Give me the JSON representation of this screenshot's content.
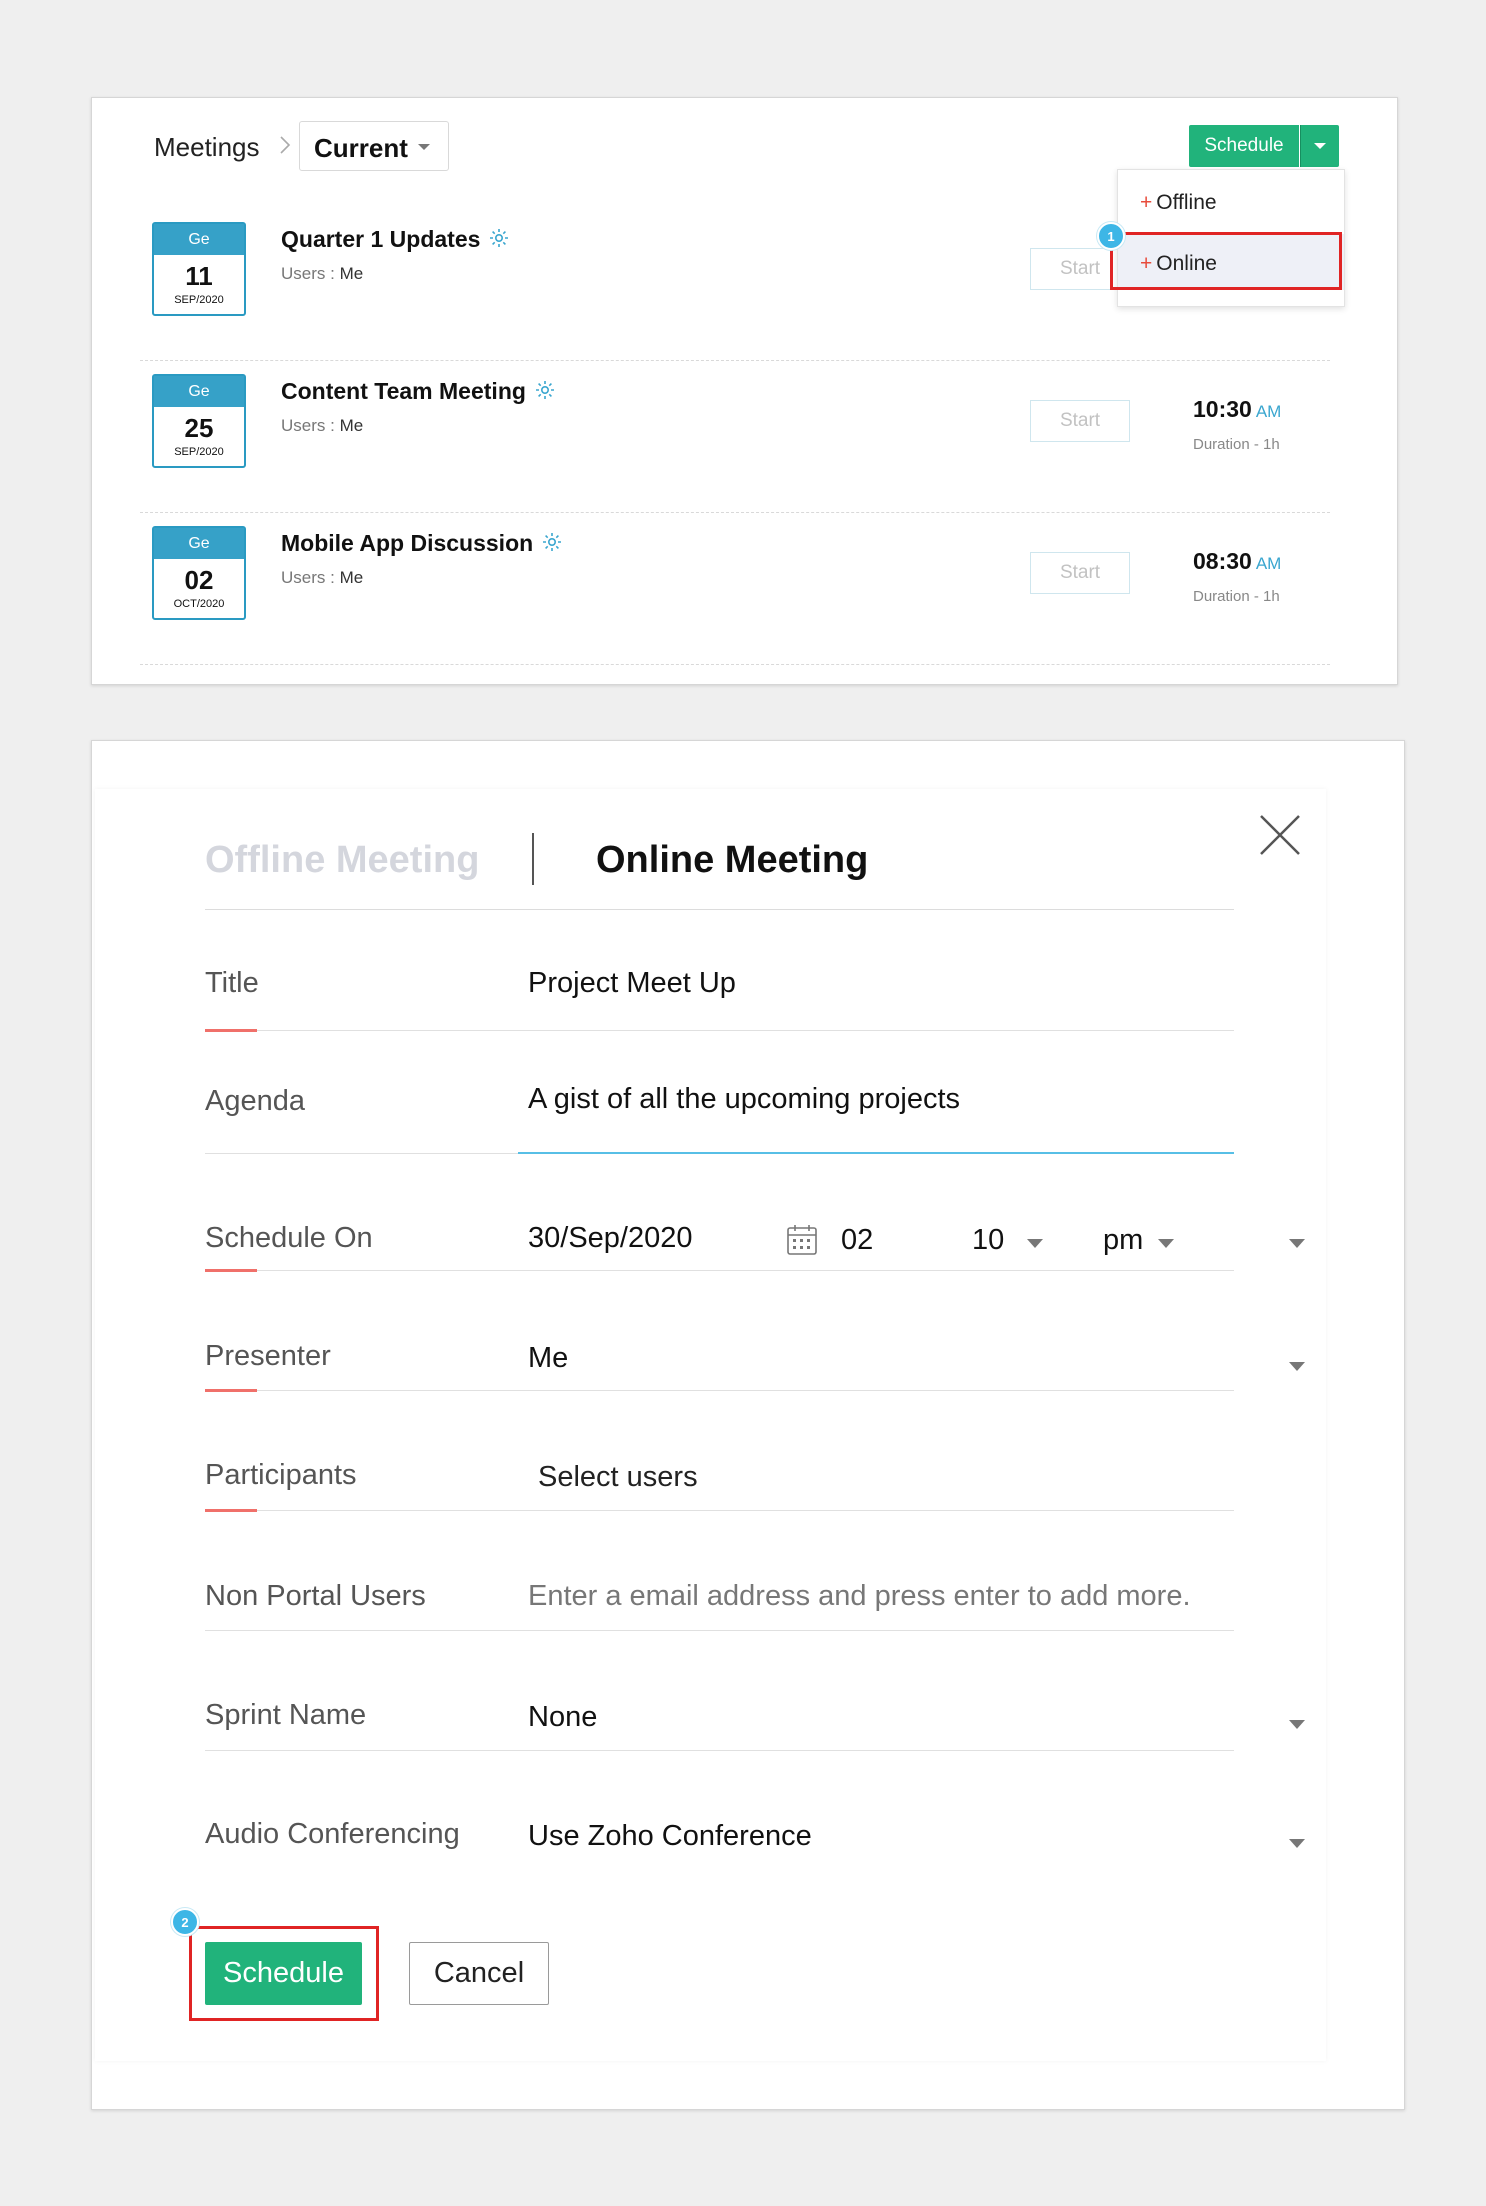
{
  "breadcrumb": {
    "root": "Meetings",
    "separator": ">",
    "current": "Current"
  },
  "schedule_button": {
    "label": "Schedule"
  },
  "schedule_menu": {
    "items": [
      {
        "plus": "+",
        "label": "Offline"
      },
      {
        "plus": "+",
        "label": "Online"
      }
    ]
  },
  "steps": [
    "1",
    "2"
  ],
  "meetings": [
    {
      "cal_top": "Ge",
      "day": "11",
      "month_year": "SEP/2020",
      "title": "Quarter 1 Updates",
      "users_label": "Users :",
      "users": "Me",
      "start_label": "Start",
      "time": "",
      "ampm": "",
      "duration": ""
    },
    {
      "cal_top": "Ge",
      "day": "25",
      "month_year": "SEP/2020",
      "title": "Content Team Meeting",
      "users_label": "Users :",
      "users": "Me",
      "start_label": "Start",
      "time": "10:30",
      "ampm": "AM",
      "duration": "Duration - 1h"
    },
    {
      "cal_top": "Ge",
      "day": "02",
      "month_year": "OCT/2020",
      "title": "Mobile App Discussion",
      "users_label": "Users :",
      "users": "Me",
      "start_label": "Start",
      "time": "08:30",
      "ampm": "AM",
      "duration": "Duration - 1h"
    }
  ],
  "form": {
    "tab_offline": "Offline Meeting",
    "tab_online": "Online Meeting",
    "title": {
      "label": "Title",
      "value": "Project Meet Up"
    },
    "agenda": {
      "label": "Agenda",
      "value": "A gist of all the upcoming projects"
    },
    "schedule_on": {
      "label": "Schedule On",
      "date": "30/Sep/2020",
      "hour": "02",
      "minute": "10",
      "ampm": "pm"
    },
    "presenter": {
      "label": "Presenter",
      "value": "Me"
    },
    "participants": {
      "label": "Participants",
      "placeholder": "Select users"
    },
    "non_portal_users": {
      "label": "Non Portal Users",
      "placeholder": "Enter a email address and press enter to add more."
    },
    "sprint_name": {
      "label": "Sprint Name",
      "value": "None"
    },
    "audio_conferencing": {
      "label": "Audio Conferencing",
      "value": "Use Zoho Conference"
    },
    "schedule_label": "Schedule",
    "cancel_label": "Cancel"
  },
  "colors": {
    "accent_green": "#21b37b",
    "calendar_blue": "#36a1c8",
    "highlight_red": "#e02424",
    "underline_coral": "#f0706a"
  }
}
